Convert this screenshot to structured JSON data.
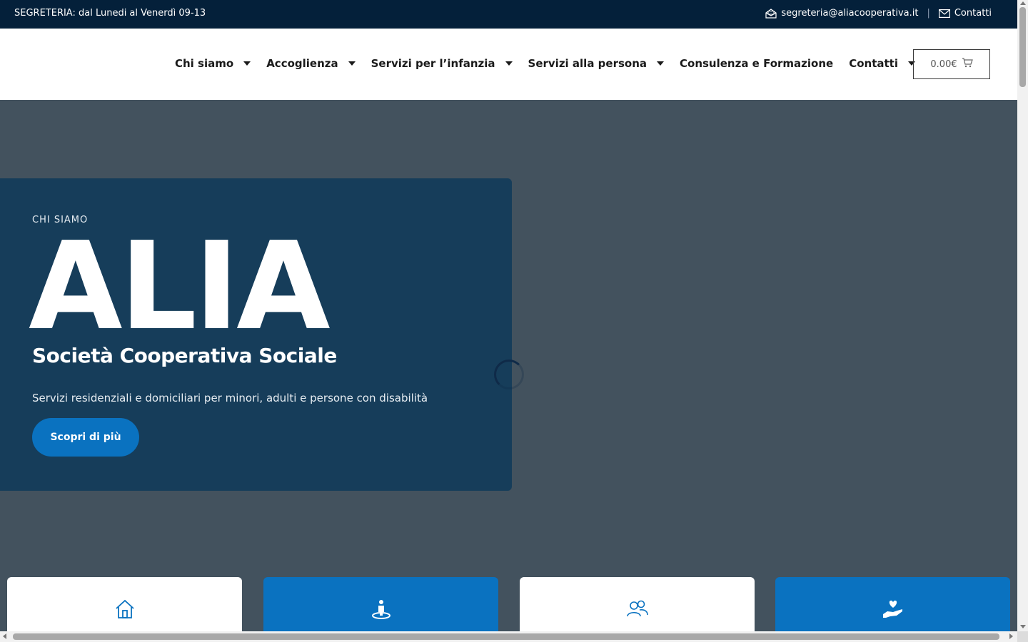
{
  "topbar": {
    "hours": "SEGRETERIA: dal Lunedi al Venerdì 09-13",
    "email": "segreteria@aliacooperativa.it",
    "separator": "|",
    "contacts": "Contatti",
    "email_icon": "envelope-open-icon",
    "contacts_icon": "envelope-icon"
  },
  "nav": {
    "items": [
      {
        "label": "Chi siamo",
        "has_dropdown": true
      },
      {
        "label": "Accoglienza",
        "has_dropdown": true
      },
      {
        "label": "Servizi per l’infanzia",
        "has_dropdown": true
      },
      {
        "label": "Servizi alla persona",
        "has_dropdown": true
      },
      {
        "label": "Consulenza e Formazione",
        "has_dropdown": false
      },
      {
        "label": "Contatti",
        "has_dropdown": true
      }
    ]
  },
  "cart": {
    "amount": "0.00€",
    "icon": "cart-icon"
  },
  "hero": {
    "eyebrow": "CHI SIAMO",
    "title": "ALIA",
    "subtitle": "Società Cooperativa Sociale",
    "description": "Servizi residenziali e domiciliari per minori, adulti e persone con disabilità",
    "cta": "Scopri di più"
  },
  "cards": [
    {
      "icon": "home-icon",
      "style": "white"
    },
    {
      "icon": "person-location-icon",
      "style": "blue"
    },
    {
      "icon": "users-icon",
      "style": "white"
    },
    {
      "icon": "hand-heart-icon",
      "style": "blue"
    }
  ],
  "colors": {
    "topbar_bg": "#04203a",
    "hero_bg": "#43525e",
    "panel_bg": "#163d5a",
    "accent_blue": "#0a72c0"
  }
}
